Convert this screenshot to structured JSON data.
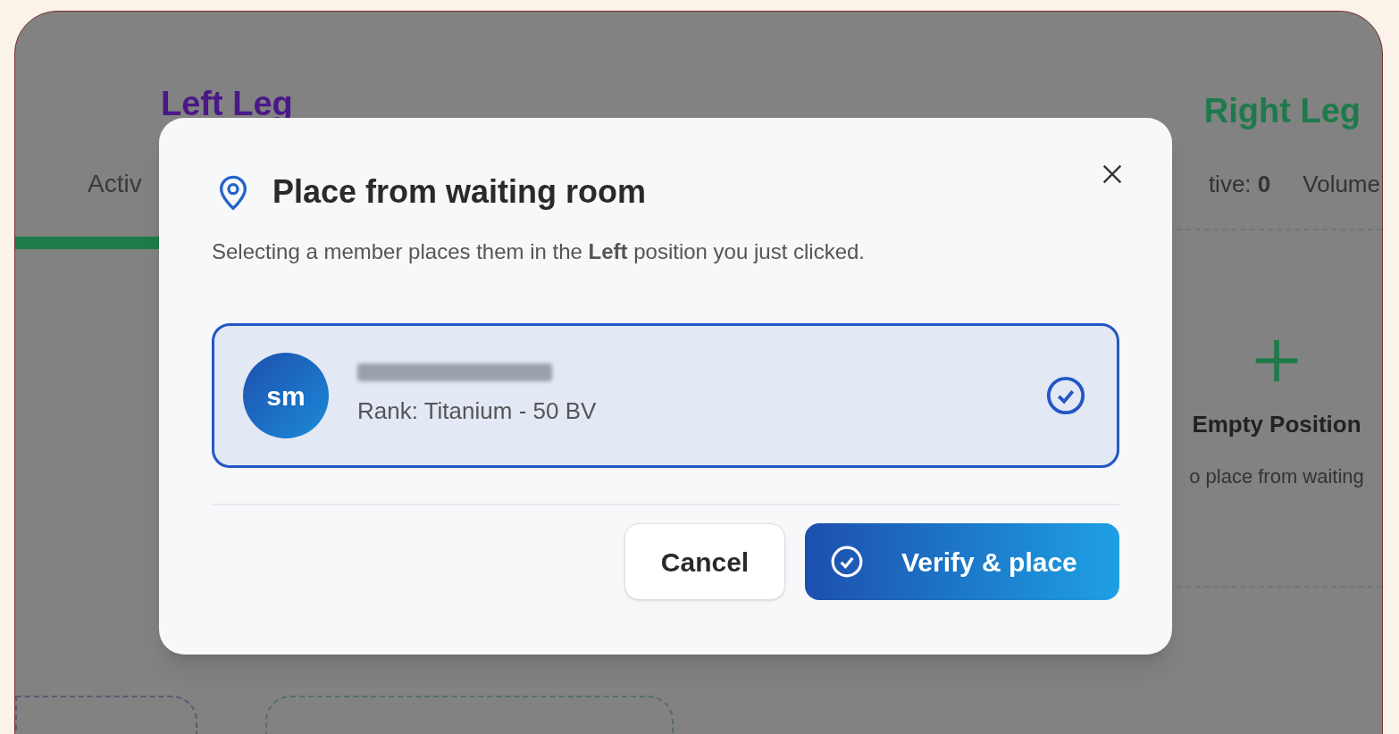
{
  "background": {
    "left_leg": {
      "title": "Left Leg",
      "stats": [
        "Activ"
      ]
    },
    "right_leg": {
      "title": "Right Leg",
      "stats": [
        "tive: **0**",
        "Volume"
      ],
      "empty_position": {
        "title": "Empty Position",
        "subtitle": "o place from waiting"
      }
    }
  },
  "dialog": {
    "title": "Place from waiting room",
    "description": "Selecting a member places them in the **Left** position you just clicked.",
    "members": [
      {
        "initials": "sm",
        "detail": "Rank: Titanium - 50 BV",
        "selected": true
      }
    ],
    "buttons": [
      {
        "label": "Cancel",
        "kind": "secondary"
      },
      {
        "label": "Verify & place",
        "kind": "primary"
      }
    ]
  }
}
